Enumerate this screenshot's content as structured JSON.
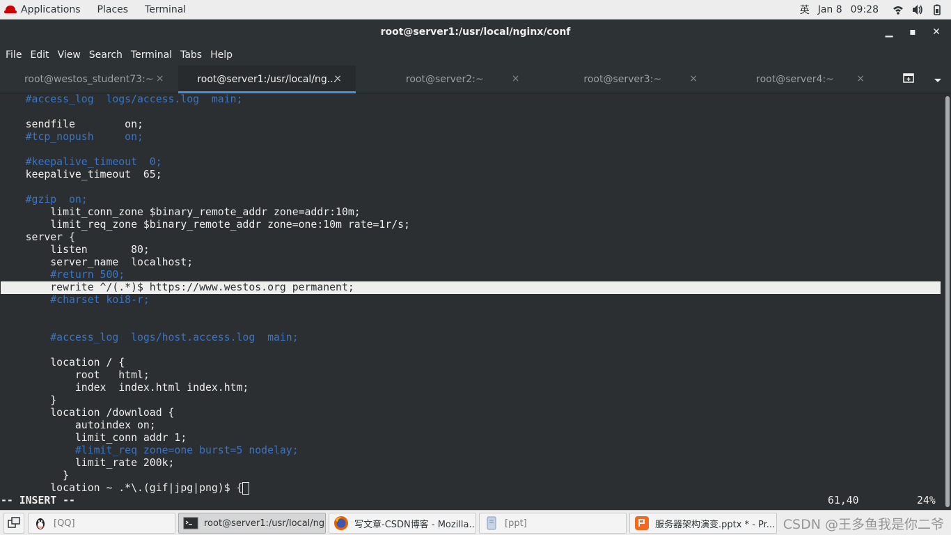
{
  "topbar": {
    "applications": "Applications",
    "places": "Places",
    "terminal": "Terminal",
    "ime": "英",
    "date": "Jan 8",
    "time": "09:28"
  },
  "window": {
    "title": "root@server1:/usr/local/nginx/conf",
    "minimize": "▁",
    "maximize": "▪",
    "close": "✕"
  },
  "menubar": [
    "File",
    "Edit",
    "View",
    "Search",
    "Terminal",
    "Tabs",
    "Help"
  ],
  "tabs": [
    {
      "label": "root@westos_student73:~",
      "active": false
    },
    {
      "label": "root@server1:/usr/local/ng...",
      "active": true
    },
    {
      "label": "root@server2:~",
      "active": false
    },
    {
      "label": "root@server3:~",
      "active": false
    },
    {
      "label": "root@server4:~",
      "active": false
    }
  ],
  "tab_close": "×",
  "terminal_lines": [
    {
      "text": "    #access_log  logs/access.log  main;",
      "type": "comment"
    },
    {
      "text": "",
      "type": "normal"
    },
    {
      "text": "    sendfile        on;",
      "type": "normal"
    },
    {
      "text": "    #tcp_nopush     on;",
      "type": "comment"
    },
    {
      "text": "",
      "type": "normal"
    },
    {
      "text": "    #keepalive_timeout  0;",
      "type": "comment"
    },
    {
      "text": "    keepalive_timeout  65;",
      "type": "normal"
    },
    {
      "text": "",
      "type": "normal"
    },
    {
      "text": "    #gzip  on;",
      "type": "comment"
    },
    {
      "text": "        limit_conn_zone $binary_remote_addr zone=addr:10m;",
      "type": "normal"
    },
    {
      "text": "        limit_req_zone $binary_remote_addr zone=one:10m rate=1r/s;",
      "type": "normal"
    },
    {
      "text": "    server {",
      "type": "normal"
    },
    {
      "text": "        listen       80;",
      "type": "normal"
    },
    {
      "text": "        server_name  localhost;",
      "type": "normal"
    },
    {
      "text": "        #return 500;",
      "type": "comment"
    },
    {
      "text": "        rewrite ^/(.*)$ https://www.westos.org permanent;",
      "type": "cursorline"
    },
    {
      "text": "        #charset koi8-r;",
      "type": "comment"
    },
    {
      "text": "",
      "type": "normal"
    },
    {
      "text": "",
      "type": "normal"
    },
    {
      "text": "        #access_log  logs/host.access.log  main;",
      "type": "comment"
    },
    {
      "text": "",
      "type": "normal"
    },
    {
      "text": "        location / {",
      "type": "normal"
    },
    {
      "text": "            root   html;",
      "type": "normal"
    },
    {
      "text": "            index  index.html index.htm;",
      "type": "normal"
    },
    {
      "text": "        }",
      "type": "normal"
    },
    {
      "text": "        location /download {",
      "type": "normal"
    },
    {
      "text": "            autoindex on;",
      "type": "normal"
    },
    {
      "text": "            limit_conn addr 1;",
      "type": "normal"
    },
    {
      "text": "            #limit_req zone=one burst=5 nodelay;",
      "type": "comment"
    },
    {
      "text": "            limit_rate 200k;",
      "type": "normal"
    },
    {
      "text": "          }",
      "type": "normal"
    },
    {
      "text": "        location ~ .*\\.(gif|jpg|png)$ {",
      "type": "cursor"
    }
  ],
  "status": {
    "mode": "-- INSERT --",
    "position": "61,40",
    "percent": "24%"
  },
  "taskbar": [
    {
      "label": "[QQ]",
      "icon": "qq-penguin-icon",
      "active": false,
      "dim": true
    },
    {
      "label": "root@server1:/usr/local/ng...",
      "icon": "terminal-icon",
      "active": true,
      "dim": false
    },
    {
      "label": "写文章-CSDN博客 - Mozilla...",
      "icon": "firefox-icon",
      "active": false,
      "dim": false
    },
    {
      "label": "[ppt]",
      "icon": "file-manager-icon",
      "active": false,
      "dim": true
    },
    {
      "label": "服务器架构演变.pptx * - Pr...",
      "icon": "presentation-icon",
      "active": false,
      "dim": false
    }
  ],
  "watermark": "CSDN @王多鱼我是你二爷",
  "colors": {
    "terminal_bg": "#2b2f31",
    "comment": "#3a74c4",
    "tab_accent": "#4a90d9"
  }
}
